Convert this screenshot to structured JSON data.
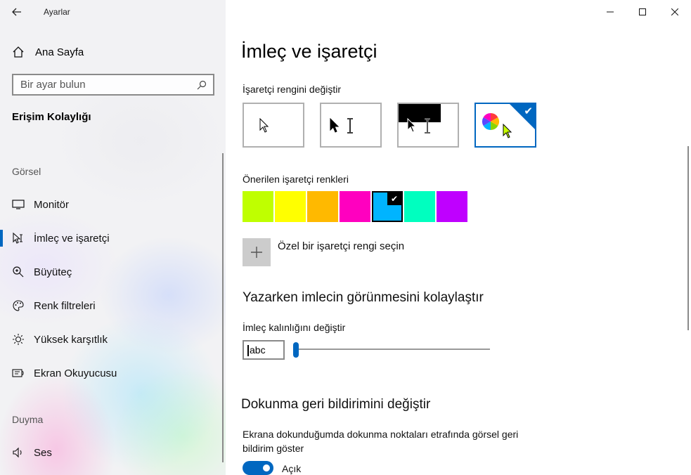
{
  "app": {
    "title": "Ayarlar"
  },
  "sidebar": {
    "home_label": "Ana Sayfa",
    "search_placeholder": "Bir ayar bulun",
    "section_title": "Erişim Kolaylığı",
    "groups": [
      "Görsel",
      "Duyma"
    ],
    "items": [
      {
        "label": "Monitör",
        "icon": "monitor-icon"
      },
      {
        "label": "İmleç ve işaretçi",
        "icon": "pointer-icon",
        "active": true
      },
      {
        "label": "Büyüteç",
        "icon": "magnifier-icon"
      },
      {
        "label": "Renk filtreleri",
        "icon": "palette-icon"
      },
      {
        "label": "Yüksek karşıtlık",
        "icon": "sun-icon"
      },
      {
        "label": "Ekran Okuyucusu",
        "icon": "narrator-icon"
      },
      {
        "label": "Ses",
        "icon": "speaker-icon"
      }
    ]
  },
  "main": {
    "title": "İmleç ve işaretçi",
    "pointer_color_label": "İşaretçi rengini değiştir",
    "pointer_options": [
      "white",
      "black",
      "inverted",
      "custom-color"
    ],
    "selected_pointer_option": "custom-color",
    "suggested_label": "Önerilen işaretçi renkleri",
    "swatches": [
      "#bfff00",
      "#ffff00",
      "#ffb900",
      "#ff00bf",
      "#00b4ff",
      "#00ffbf",
      "#bf00ff"
    ],
    "selected_swatch": "#00b4ff",
    "custom_color_label": "Özel bir işaretçi rengi seçin",
    "typing_heading": "Yazarken imlecin görünmesini kolaylaştır",
    "thickness_label": "İmleç kalınlığını değiştir",
    "thickness_preview": "abc",
    "thickness_value": 1,
    "touch_heading": "Dokunma geri bildirimini değiştir",
    "touch_desc": "Ekrana dokunduğumda dokunma noktaları etrafında görsel geri bildirim göster",
    "toggle_label": "Açık",
    "toggle_on": true
  },
  "colors": {
    "accent": "#0067c0"
  }
}
